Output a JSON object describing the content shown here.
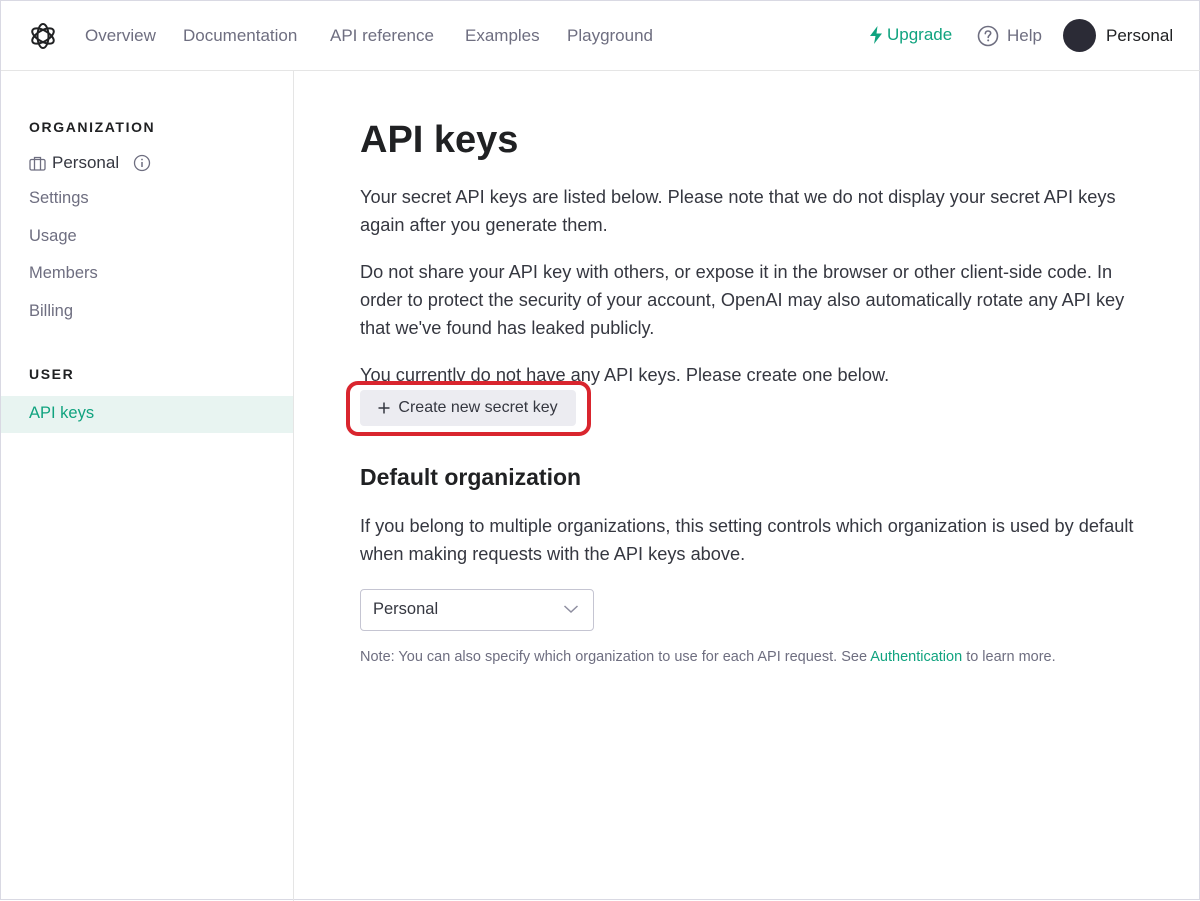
{
  "nav": {
    "links": [
      "Overview",
      "Documentation",
      "API reference",
      "Examples",
      "Playground"
    ],
    "upgrade_label": "Upgrade",
    "help_label": "Help",
    "profile_name": "Personal"
  },
  "sidebar": {
    "organization_heading": "ORGANIZATION",
    "org_name": "Personal",
    "org_items": [
      "Settings",
      "Usage",
      "Members",
      "Billing"
    ],
    "user_heading": "USER",
    "active_item": "API keys"
  },
  "main": {
    "title": "API keys",
    "intro": "Your secret API keys are listed below. Please note that we do not display your secret API keys again after you generate them.",
    "warning": "Do not share your API key with others, or expose it in the browser or other client-side code. In order to protect the security of your account, OpenAI may also automatically rotate any API key that we've found has leaked publicly.",
    "empty_state": "You currently do not have any API keys. Please create one below.",
    "create_button_label": "Create new secret key",
    "default_org_title": "Default organization",
    "default_org_desc": "If you belong to multiple organizations, this setting controls which organization is used by default when making requests with the API keys above.",
    "org_select_value": "Personal",
    "note_prefix": "Note: You can also specify which organization to use for each API request. See",
    "note_link": "Authentication",
    "note_suffix": "to learn more."
  },
  "colors": {
    "accent": "#10a37f",
    "highlight": "#d9252e"
  }
}
